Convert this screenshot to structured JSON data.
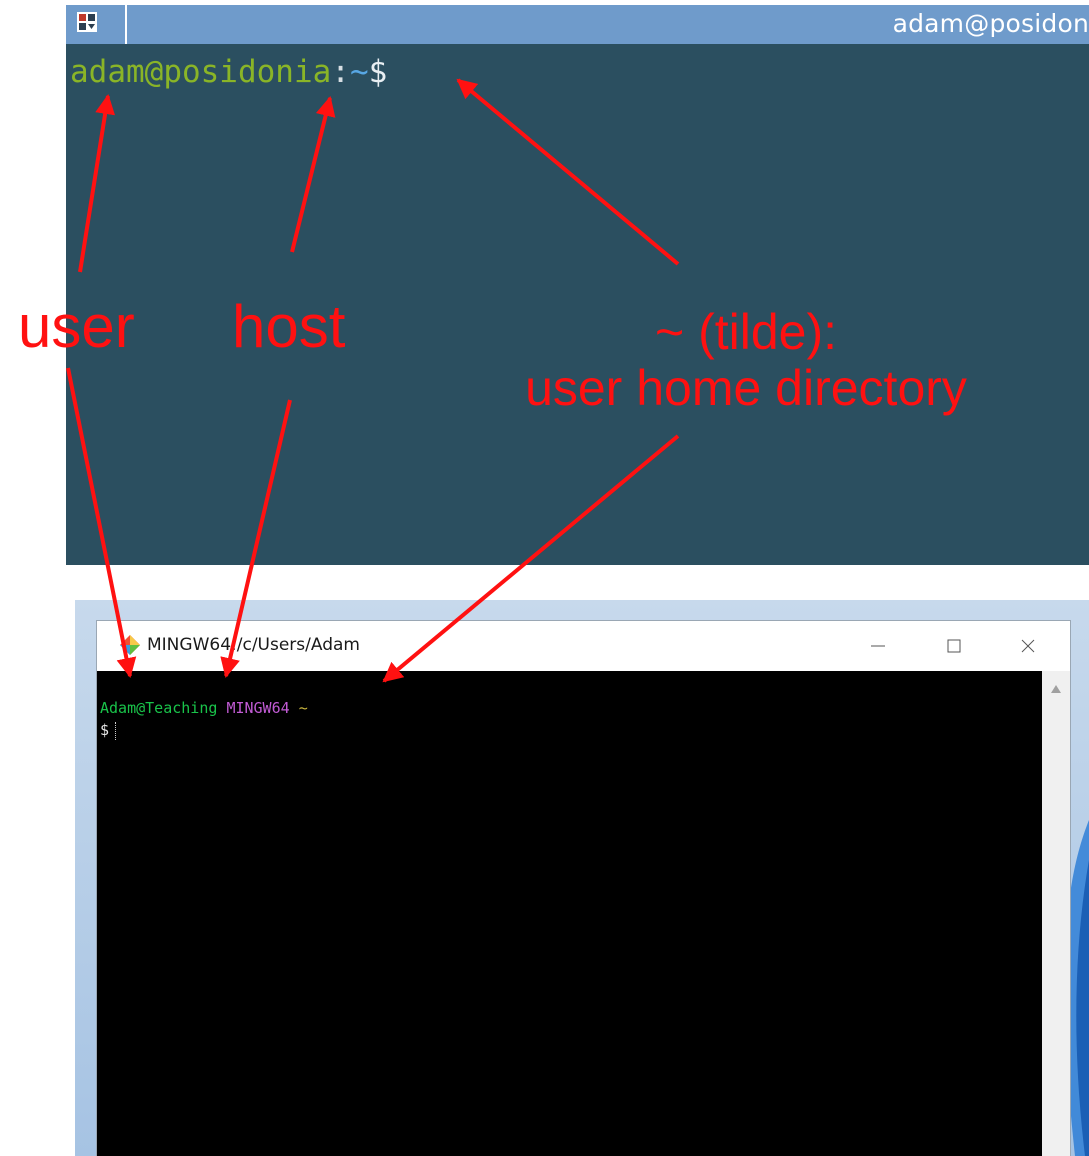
{
  "top_terminal": {
    "window_title": "adam@posidon",
    "prompt": {
      "user_host": "adam@posidonia",
      "colon": ":",
      "dir": "~",
      "dollar": "$"
    }
  },
  "mingw_window": {
    "title": "MINGW64:/c/Users/Adam",
    "controls": {
      "minimize": "—",
      "maximize": "☐",
      "close": "✕"
    },
    "lines": {
      "user_host": "Adam@Teaching",
      "system": "MINGW64",
      "path": "~",
      "dollar": "$"
    }
  },
  "annotations": {
    "user": "user",
    "host": "host",
    "tilde_line1": "~ (tilde):",
    "tilde_line2": "user home directory"
  },
  "colors": {
    "annotation": "#ff1111",
    "top_terminal_bg": "#2b4f60",
    "top_titlebar": "#6f9bcb",
    "prompt_user": "#8ab527",
    "prompt_dir": "#58a7e4",
    "mingw_user": "#19c34a",
    "mingw_system": "#c15bd4",
    "mingw_path": "#c9b63e"
  }
}
